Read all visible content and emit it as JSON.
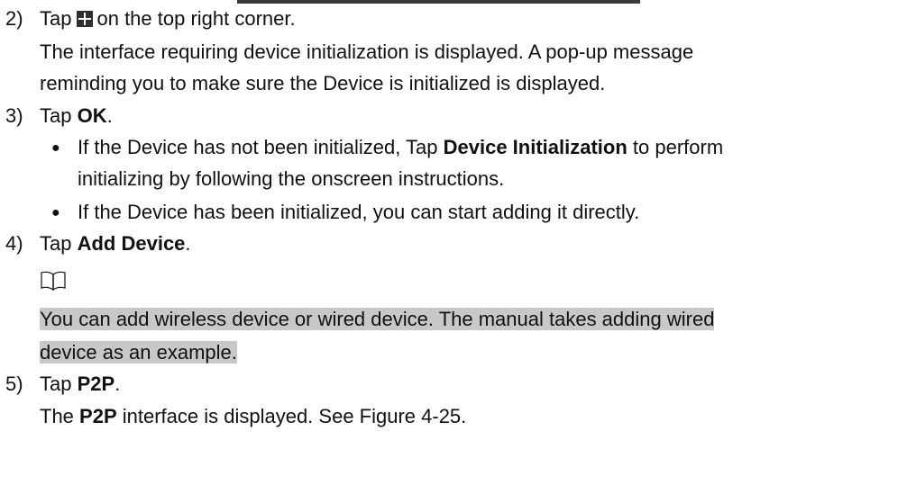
{
  "steps": [
    {
      "num": "2)",
      "pre": "Tap",
      "icon": "plus-icon",
      "post": "on the top right corner."
    },
    {
      "num": "3)",
      "pre": "Tap ",
      "bold": "OK",
      "post": "."
    },
    {
      "num": "4)",
      "pre": "Tap ",
      "bold": "Add Device",
      "post": "."
    },
    {
      "num": "5)",
      "pre": "Tap ",
      "bold": "P2P",
      "post": "."
    }
  ],
  "step2_result": [
    "The interface requiring device initialization is displayed. A pop-up message",
    "reminding you to make sure the Device is initialized is displayed."
  ],
  "step3_bullets": [
    {
      "bullet": "●",
      "pre": "If the Device has not been initialized, Tap ",
      "bold": "Device Initialization",
      "post": " to perform",
      "cont": "initializing by following the onscreen instructions."
    },
    {
      "bullet": "●",
      "text": "If the Device has been initialized, you can start adding it directly."
    }
  ],
  "note": {
    "icon": "book-icon",
    "lines": [
      "You can add wireless device or wired device. The manual takes adding wired",
      "device as an example."
    ]
  },
  "step5_result": {
    "pre": "The ",
    "bold": "P2P",
    "post": " interface is displayed. See Figure 4-25."
  }
}
